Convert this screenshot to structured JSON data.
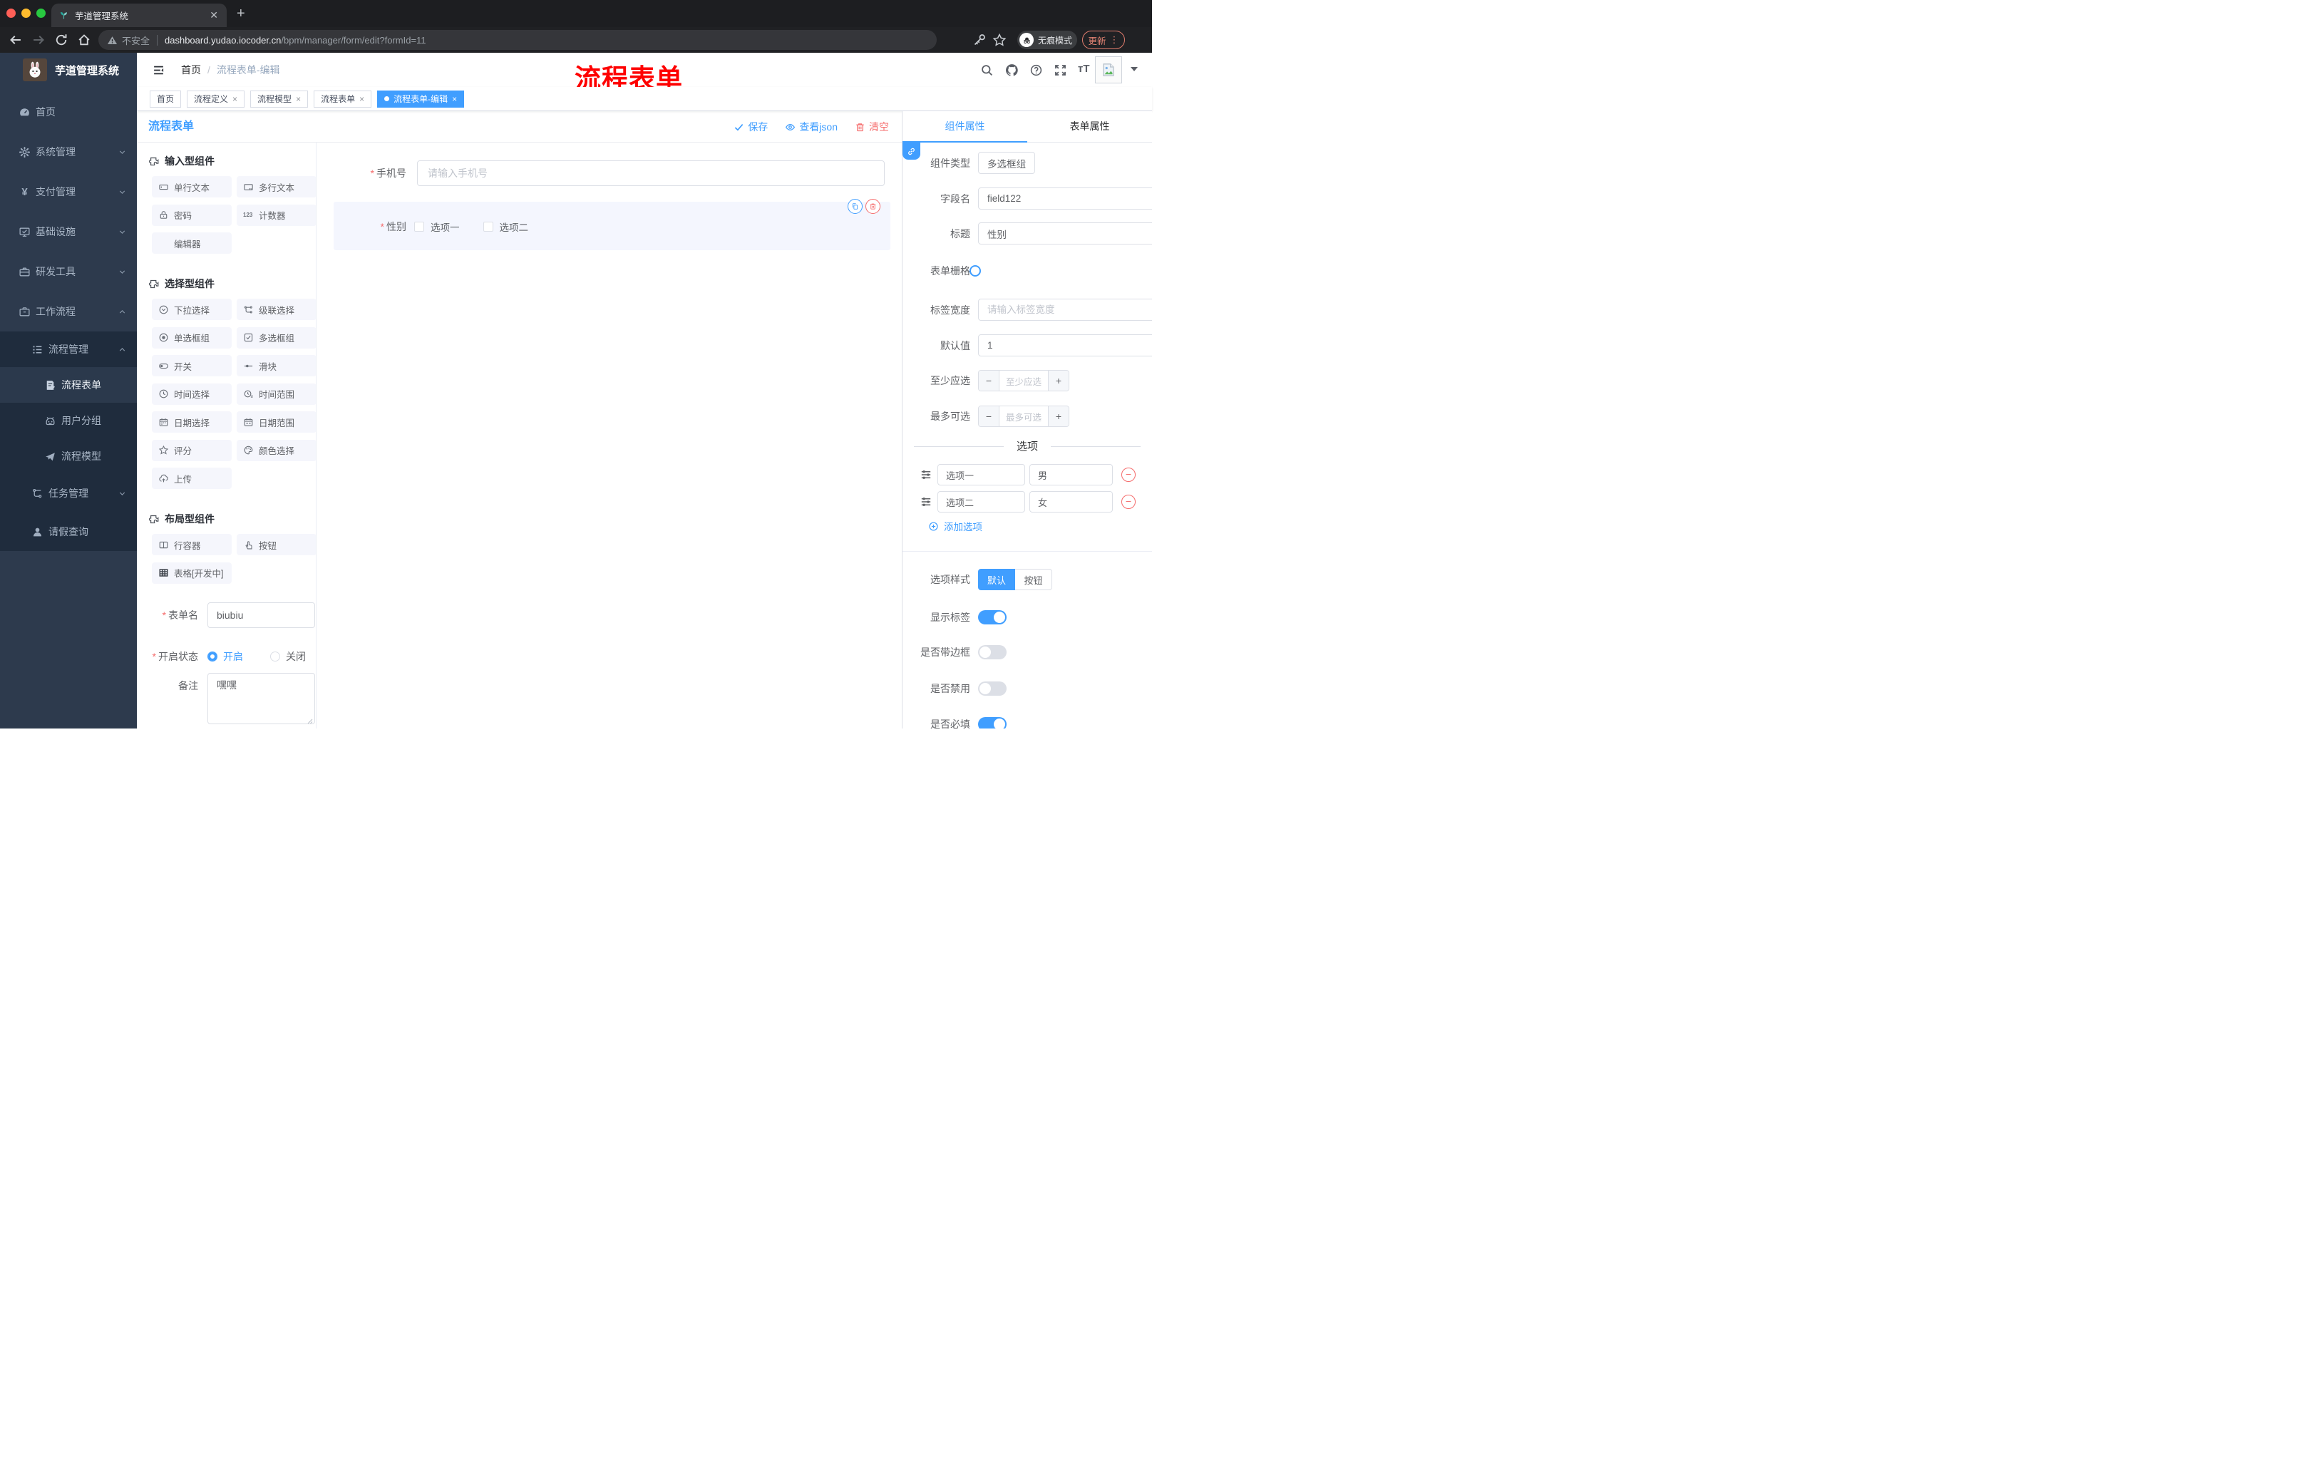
{
  "colors": {
    "primary": "#409eff",
    "danger": "#f56c6c",
    "sidebar_bg": "#2d3a4d",
    "submenu_bg": "#1f2c3d",
    "tag_active": "#409eff",
    "annotation_red": "#fe0000"
  },
  "browser": {
    "tab_title": "芋道管理系统",
    "not_secure": "不安全",
    "url_host": "dashboard.yudao.iocoder.cn",
    "url_path": "/bpm/manager/form/edit?formId=11",
    "incognito_label": "无痕模式",
    "update_label": "更新"
  },
  "sidebar": {
    "title": "芋道管理系统",
    "items": [
      {
        "label": "首页"
      },
      {
        "label": "系统管理"
      },
      {
        "label": "支付管理"
      },
      {
        "label": "基础设施"
      },
      {
        "label": "研发工具"
      },
      {
        "label": "工作流程"
      },
      {
        "label": "流程管理"
      },
      {
        "label": "流程表单"
      },
      {
        "label": "用户分组"
      },
      {
        "label": "流程模型"
      },
      {
        "label": "任务管理"
      },
      {
        "label": "请假查询"
      }
    ]
  },
  "header": {
    "breadcrumb_home": "首页",
    "breadcrumb_current": "流程表单-编辑",
    "annotation": "流程表单"
  },
  "tags": [
    {
      "label": "首页"
    },
    {
      "label": "流程定义"
    },
    {
      "label": "流程模型"
    },
    {
      "label": "流程表单"
    },
    {
      "label": "流程表单-编辑"
    }
  ],
  "toolbar": {
    "title": "流程表单",
    "save": "保存",
    "view_json": "查看json",
    "clear": "清空"
  },
  "components": {
    "section_input": "输入型组件",
    "input_items": [
      "单行文本",
      "多行文本",
      "密码",
      "计数器",
      "编辑器"
    ],
    "section_select": "选择型组件",
    "select_items": [
      "下拉选择",
      "级联选择",
      "单选框组",
      "多选框组",
      "开关",
      "滑块",
      "时间选择",
      "时间范围",
      "日期选择",
      "日期范围",
      "评分",
      "颜色选择",
      "上传"
    ],
    "section_layout": "布局型组件",
    "layout_items": [
      "行容器",
      "按钮",
      "表格[开发中]"
    ]
  },
  "form_meta": {
    "name_label": "表单名",
    "name_value": "biubiu",
    "status_label": "开启状态",
    "status_on": "开启",
    "status_off": "关闭",
    "remark_label": "备注",
    "remark_value": "嘿嘿"
  },
  "canvas": {
    "phone_label": "手机号",
    "phone_placeholder": "请输入手机号",
    "gender_label": "性别",
    "gender_opt1": "选项一",
    "gender_opt2": "选项二"
  },
  "panel": {
    "tab_component": "组件属性",
    "tab_form": "表单属性",
    "type_label": "组件类型",
    "type_value": "多选框组",
    "field_label": "字段名",
    "field_value": "field122",
    "title_label": "标题",
    "title_value": "性别",
    "grid_label": "表单栅格",
    "labelw_label": "标签宽度",
    "labelw_placeholder": "请输入标签宽度",
    "default_label": "默认值",
    "default_value": "1",
    "min_label": "至少应选",
    "min_placeholder": "至少应选",
    "max_label": "最多可选",
    "max_placeholder": "最多可选",
    "options_title": "选项",
    "opt1_label": "选项一",
    "opt1_value": "男",
    "opt2_label": "选项二",
    "opt2_value": "女",
    "add_option": "添加选项",
    "style_label": "选项样式",
    "style_default": "默认",
    "style_button": "按钮",
    "show_label_label": "显示标签",
    "border_label": "是否带边框",
    "disabled_label": "是否禁用",
    "required_label": "是否必填"
  }
}
